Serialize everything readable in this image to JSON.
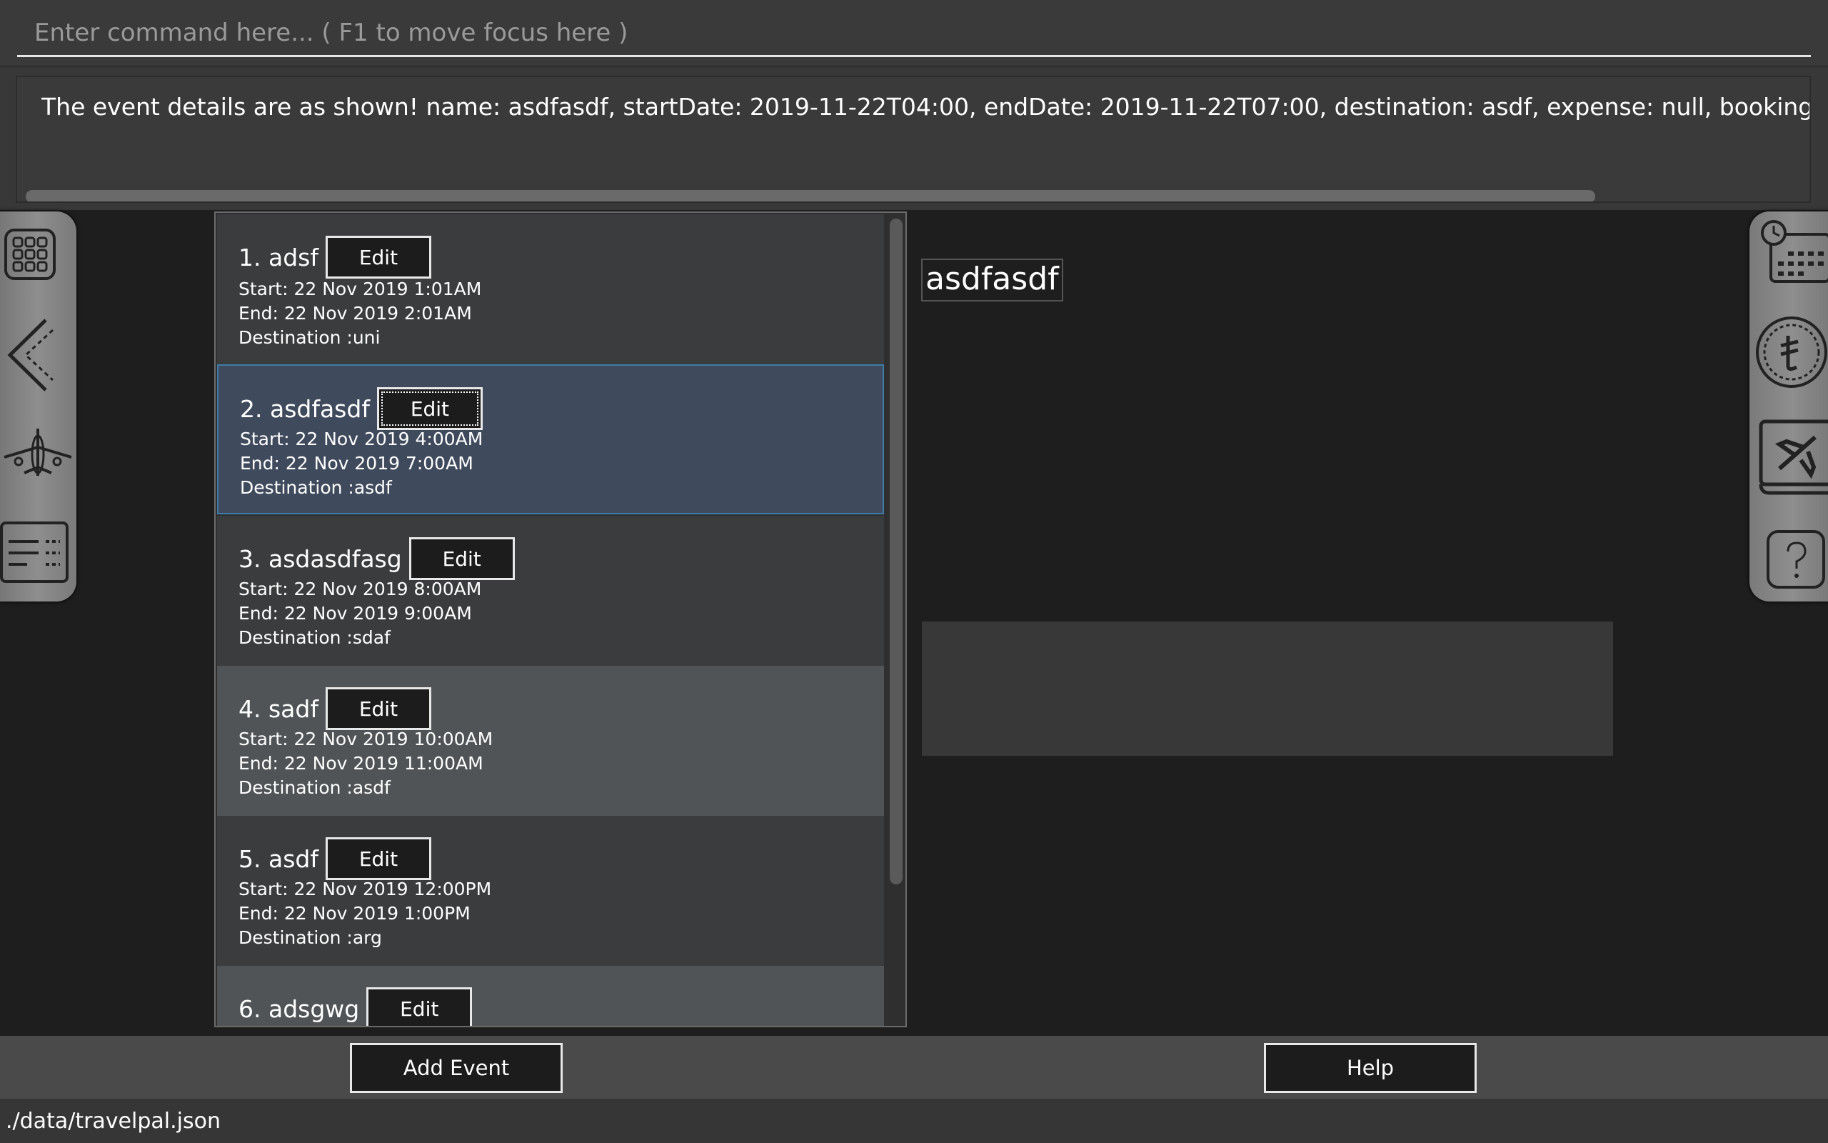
{
  "command": {
    "placeholder": "Enter command here... ( F1 to move focus here )",
    "value": ""
  },
  "result": {
    "text": "The event details are as shown! name: asdfasdf, startDate: 2019-11-22T04:00, endDate: 2019-11-22T07:00, destination: asdf, expense: null, booking: n"
  },
  "left_nav": {
    "items": [
      {
        "icon": "grid-icon"
      },
      {
        "icon": "back-arrow-icon"
      },
      {
        "icon": "airplane-icon"
      },
      {
        "icon": "itinerary-list-icon"
      }
    ]
  },
  "right_nav": {
    "items": [
      {
        "icon": "calendar-clock-icon"
      },
      {
        "icon": "expense-coin-icon"
      },
      {
        "icon": "flight-booking-icon"
      },
      {
        "icon": "help-icon"
      }
    ]
  },
  "events": {
    "edit_label": "Edit",
    "items": [
      {
        "title": "1. adsf",
        "start": "Start: 22 Nov 2019 1:01AM",
        "end": "End: 22 Nov 2019 2:01AM",
        "destination": "Destination :uni"
      },
      {
        "title": "2. asdfasdf",
        "start": "Start: 22 Nov 2019 4:00AM",
        "end": "End: 22 Nov 2019 7:00AM",
        "destination": "Destination :asdf",
        "selected": true
      },
      {
        "title": "3. asdasdfasg",
        "start": "Start: 22 Nov 2019 8:00AM",
        "end": "End: 22 Nov 2019 9:00AM",
        "destination": "Destination :sdaf"
      },
      {
        "title": "4. sadf",
        "start": "Start: 22 Nov 2019 10:00AM",
        "end": "End: 22 Nov 2019 11:00AM",
        "destination": "Destination :asdf"
      },
      {
        "title": "5. asdf",
        "start": "Start: 22 Nov 2019 12:00PM",
        "end": "End: 22 Nov 2019 1:00PM",
        "destination": "Destination :arg"
      },
      {
        "title": "6. adsgwg",
        "start": "",
        "end": "",
        "destination": ""
      }
    ]
  },
  "detail": {
    "name": "asdfasdf"
  },
  "buttons": {
    "add_event": "Add Event",
    "help": "Help"
  },
  "status": {
    "path": "./data/travelpal.json"
  }
}
